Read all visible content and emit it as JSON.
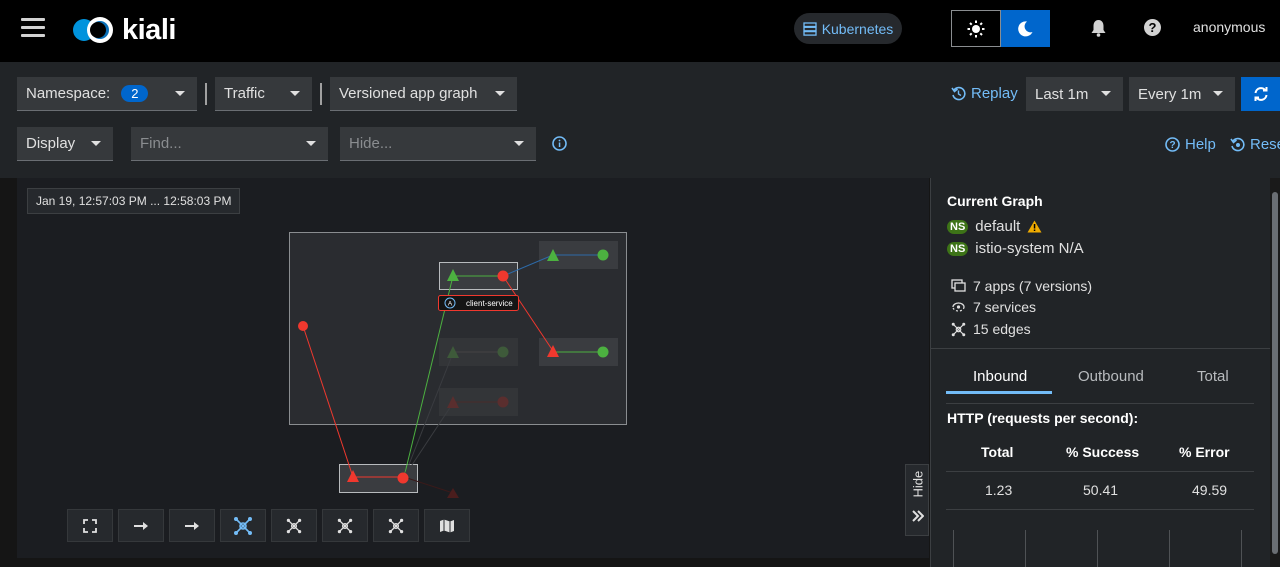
{
  "masthead": {
    "logo_text": "kiali",
    "cluster_label": "Kubernetes",
    "user": "anonymous",
    "theme_light_icon": "sun-icon",
    "theme_dark_icon": "moon-icon"
  },
  "toolbar": {
    "namespace_label": "Namespace:",
    "namespace_count": "2",
    "traffic_label": "Traffic",
    "graph_type": "Versioned app graph",
    "display_label": "Display",
    "find_placeholder": "Find...",
    "hide_placeholder": "Hide...",
    "replay_label": "Replay",
    "duration": "Last 1m",
    "refresh_interval": "Every 1m",
    "help_label": "Help",
    "reset_label": "Rese"
  },
  "graph": {
    "timestamp": "Jan 19, 12:57:03 PM ... 12:58:03 PM",
    "node_label": "client-service",
    "node_badge": "A",
    "hide_label": "Hide"
  },
  "side": {
    "title": "Current Graph",
    "namespaces": [
      {
        "badge": "NS",
        "name": "default",
        "warning": true
      },
      {
        "badge": "NS",
        "name": "istio-system N/A",
        "warning": false
      }
    ],
    "apps": "7 apps (7 versions)",
    "services": "7 services",
    "edges": "15 edges",
    "tabs": [
      "Inbound",
      "Outbound",
      "Total"
    ],
    "http_title": "HTTP (requests per second):",
    "table_headers": [
      "Total",
      "% Success",
      "% Error"
    ],
    "table_values": [
      "1.23",
      "50.41",
      "49.59"
    ]
  },
  "colors": {
    "accent": "#0066cc",
    "link": "#73bcf7",
    "ok": "#4cb140",
    "error": "#f0382e",
    "warning": "#f0ab00"
  }
}
